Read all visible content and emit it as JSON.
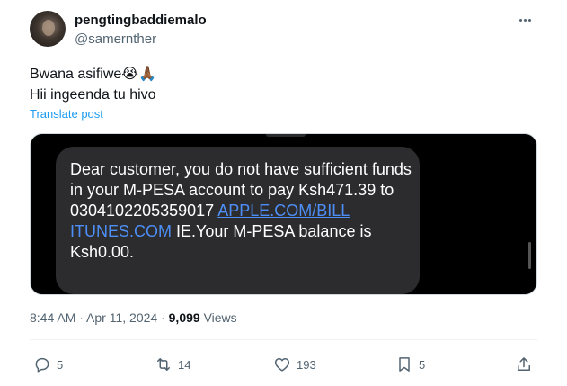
{
  "author": {
    "display_name": "pengtingbaddiemalo",
    "handle": "@samernther"
  },
  "post": {
    "line1": "Bwana asifiwe😭🙏🏾",
    "line2": "Hii ingeenda tu hivo",
    "translate_label": "Translate post"
  },
  "media": {
    "sms_part1": "Dear customer, you do not have sufficient funds in your M-PESA account to pay Ksh471.39 to 0304102205359017 ",
    "sms_link1": "APPLE.COM/BILL",
    "sms_link2": "ITUNES.COM",
    "sms_part2": " IE.Your M-PESA balance is Ksh0.00."
  },
  "meta": {
    "time": "8:44 AM",
    "separator1": " · ",
    "date": "Apr 11, 2024",
    "separator2": " · ",
    "views_count": "9,099",
    "views_label": " Views"
  },
  "actions": {
    "replies": "5",
    "reposts": "14",
    "likes": "193",
    "bookmarks": "5"
  },
  "icons": [
    "more-icon",
    "reply-icon",
    "repost-icon",
    "like-icon",
    "bookmark-icon",
    "share-icon"
  ],
  "colors": {
    "link_blue": "#1d9bf0",
    "secondary_text": "#536471",
    "sms_bubble": "#2c2c2e",
    "sms_link": "#4d8ff7"
  }
}
